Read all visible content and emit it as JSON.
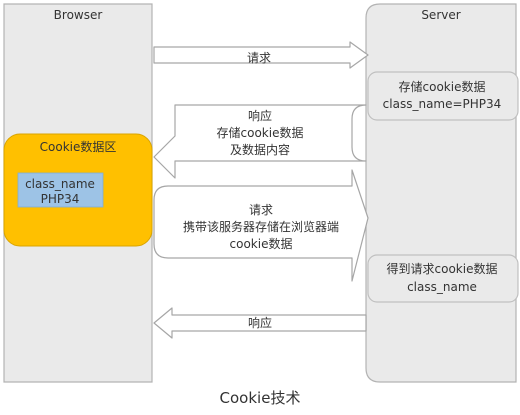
{
  "diagram": {
    "browser": {
      "title": "Browser",
      "cookie_area_title": "Cookie数据区",
      "cookie_entry": {
        "name": "class_name",
        "value": "PHP34"
      }
    },
    "server": {
      "title": "Server",
      "box1": {
        "line1": "存储cookie数据",
        "line2": "class_name=PHP34"
      },
      "box2": {
        "line1": "得到请求cookie数据",
        "line2": "class_name"
      }
    },
    "arrows": {
      "request1": {
        "label": "请求"
      },
      "response1": {
        "lines": [
          "响应",
          "存储cookie数据",
          "及数据内容"
        ]
      },
      "request2": {
        "lines": [
          "请求",
          "携带该服务器存储在浏览器端",
          "cookie数据"
        ]
      },
      "response2": {
        "label": "响应"
      }
    },
    "caption": "Cookie技术"
  },
  "colors": {
    "column_fill": "#eaeaea",
    "column_stroke": "#b3b3b3",
    "cookie_area_fill": "#ffc000",
    "cookie_entry_fill": "#9dc3e6",
    "arrow_fill": "#ffffff",
    "arrow_stroke": "#a6a6a6"
  }
}
